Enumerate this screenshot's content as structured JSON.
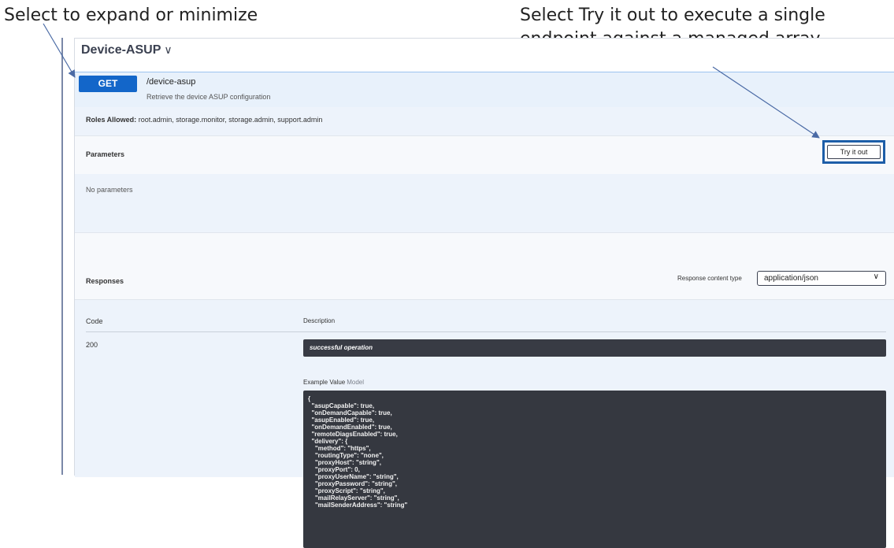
{
  "callouts": {
    "left": "Select to expand or minimize",
    "right_line1": "Select Try it out to execute a single",
    "right_line2": "endpoint against a managed array"
  },
  "section": {
    "title": "Device-ASUP",
    "chevron": "chevron-down-icon"
  },
  "operation": {
    "method": "GET",
    "path": "/device-asup",
    "summary": "Retrieve the device ASUP configuration",
    "roles_label": "Roles Allowed:",
    "roles_value": "root.admin, storage.monitor, storage.admin, support.admin"
  },
  "parameters": {
    "title": "Parameters",
    "try_button": "Try it out",
    "empty": "No parameters"
  },
  "responses": {
    "title": "Responses",
    "content_type_label": "Response content type",
    "content_type_value": "application/json",
    "col_code": "Code",
    "col_description": "Description",
    "code": "200",
    "description": "successful operation",
    "example_label": "Example Value",
    "model_label": "Model",
    "example_lines": [
      "{",
      "  \"asupCapable\": true,",
      "  \"onDemandCapable\": true,",
      "  \"asupEnabled\": true,",
      "  \"onDemandEnabled\": true,",
      "  \"remoteDiagsEnabled\": true,",
      "  \"delivery\": {",
      "    \"method\": \"https\",",
      "    \"routingType\": \"none\",",
      "    \"proxyHost\": \"string\",",
      "    \"proxyPort\": 0,",
      "    \"proxyUserName\": \"string\",",
      "    \"proxyPassword\": \"string\",",
      "    \"proxyScript\": \"string\",",
      "    \"mailRelayServer\": \"string\",",
      "    \"mailSenderAddress\": \"string\""
    ]
  },
  "colors": {
    "method_badge": "#1366c9",
    "highlight_box": "#1d5ea8",
    "code_background": "#353840"
  }
}
